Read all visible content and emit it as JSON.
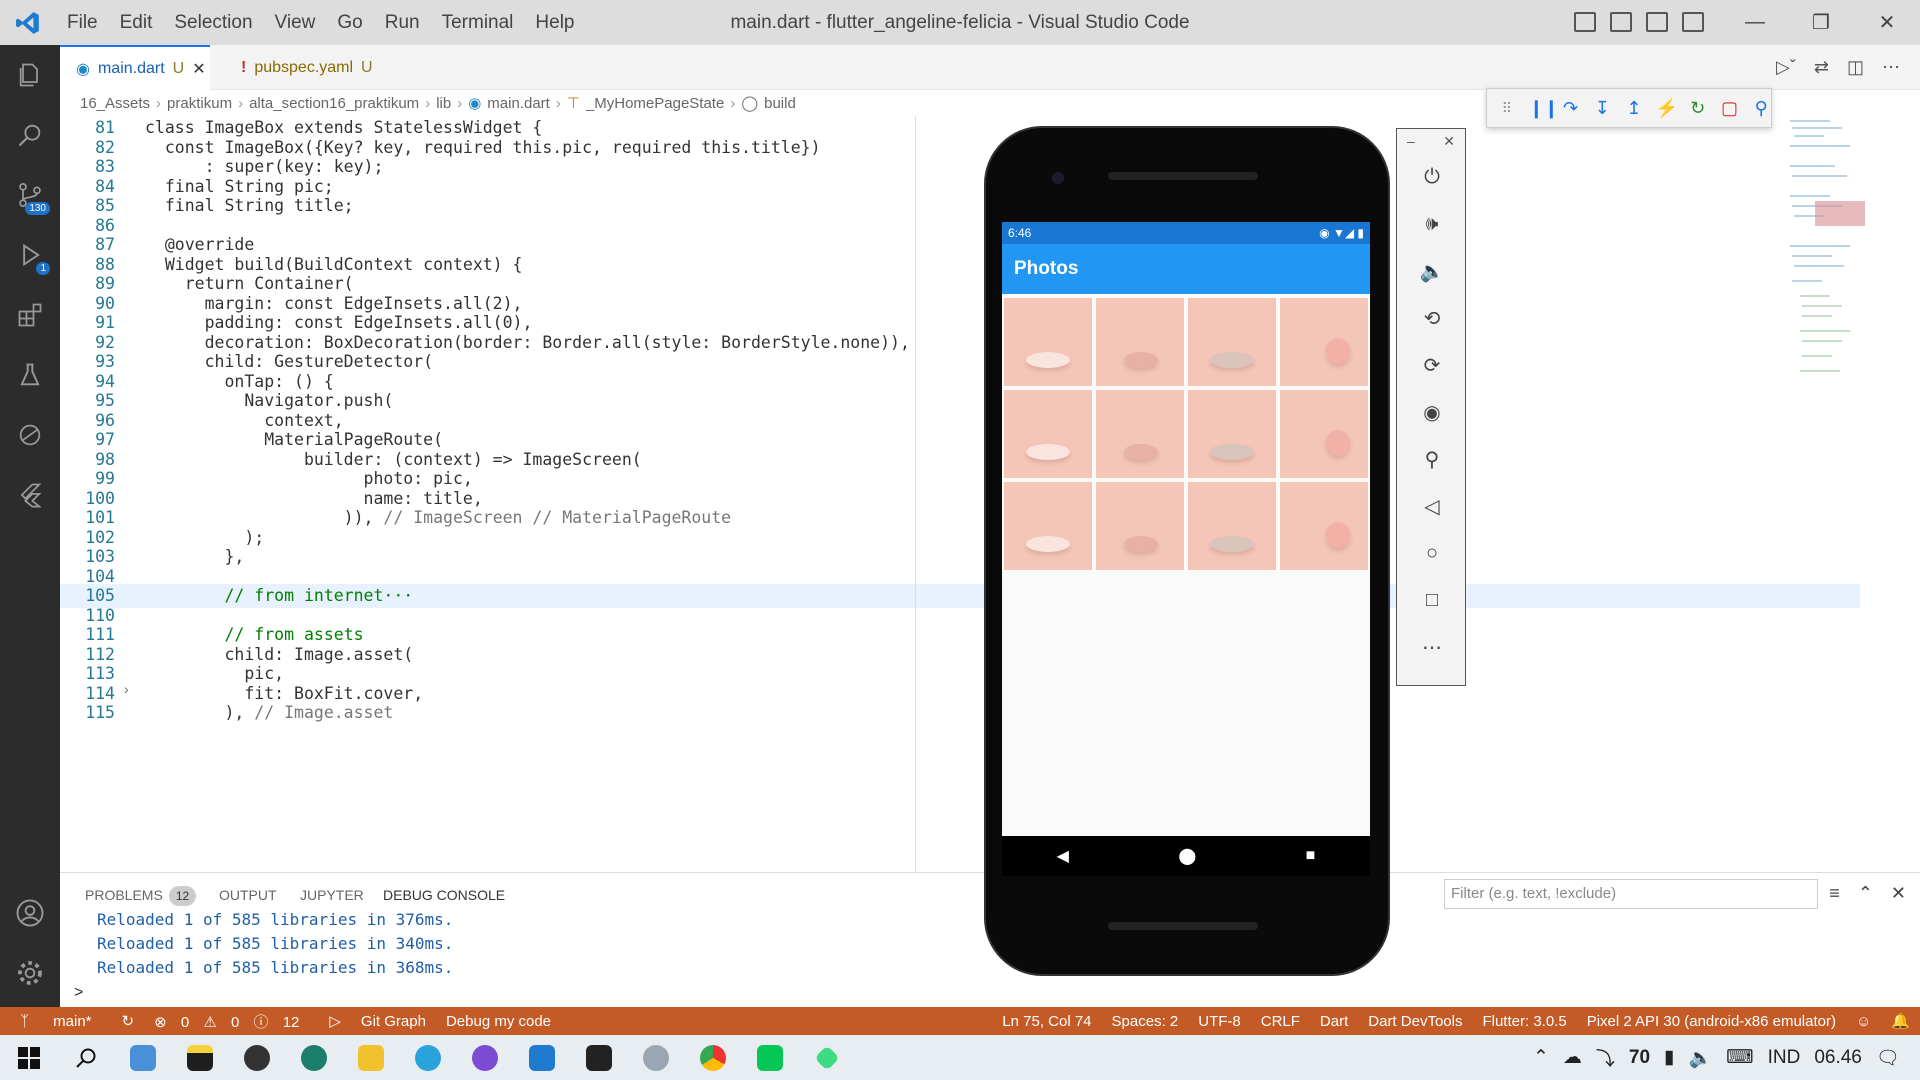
{
  "window": {
    "title": "main.dart - flutter_angeline-felicia - Visual Studio Code",
    "menu": [
      "File",
      "Edit",
      "Selection",
      "View",
      "Go",
      "Run",
      "Terminal",
      "Help"
    ]
  },
  "tabs": [
    {
      "label": "main.dart",
      "status": "U"
    },
    {
      "label": "pubspec.yaml",
      "status": "U"
    }
  ],
  "breadcrumb": [
    "16_Assets",
    "praktikum",
    "alta_section16_praktikum",
    "lib",
    "main.dart",
    "_MyHomePageState",
    "build"
  ],
  "activity": {
    "scm_badge": "130",
    "debug_badge": "1"
  },
  "code": {
    "lines": [
      {
        "n": "81",
        "text": "class ImageBox extends StatelessWidget {"
      },
      {
        "n": "82",
        "text": "  const ImageBox({Key? key, required this.pic, required this.title})"
      },
      {
        "n": "83",
        "text": "      : super(key: key);"
      },
      {
        "n": "84",
        "text": "  final String pic;"
      },
      {
        "n": "85",
        "text": "  final String title;"
      },
      {
        "n": "86",
        "text": ""
      },
      {
        "n": "87",
        "text": "  @override"
      },
      {
        "n": "88",
        "text": "  Widget build(BuildContext context) {"
      },
      {
        "n": "89",
        "text": "    return Container("
      },
      {
        "n": "90",
        "text": "      margin: const EdgeInsets.all(2),"
      },
      {
        "n": "91",
        "text": "      padding: const EdgeInsets.all(0),"
      },
      {
        "n": "92",
        "text": "      decoration: BoxDecoration(border: Border.all(style: BorderStyle.none)),"
      },
      {
        "n": "93",
        "text": "      child: GestureDetector("
      },
      {
        "n": "94",
        "text": "        onTap: () {"
      },
      {
        "n": "95",
        "text": "          Navigator.push("
      },
      {
        "n": "96",
        "text": "            context,"
      },
      {
        "n": "97",
        "text": "            MaterialPageRoute("
      },
      {
        "n": "98",
        "text": "                builder: (context) => ImageScreen("
      },
      {
        "n": "99",
        "text": "                      photo: pic,"
      },
      {
        "n": "100",
        "text": "                      name: title,"
      },
      {
        "n": "101",
        "text": "                    )), // ImageScreen // MaterialPageRoute"
      },
      {
        "n": "102",
        "text": "          );"
      },
      {
        "n": "103",
        "text": "        },"
      },
      {
        "n": "104",
        "text": ""
      },
      {
        "n": "105",
        "text": "        // from internet···"
      },
      {
        "n": "110",
        "text": ""
      },
      {
        "n": "111",
        "text": "        // from assets"
      },
      {
        "n": "112",
        "text": "        child: Image.asset("
      },
      {
        "n": "113",
        "text": "          pic,"
      },
      {
        "n": "114",
        "text": "          fit: BoxFit.cover,"
      },
      {
        "n": "115",
        "text": "        ), // Image.asset"
      }
    ]
  },
  "panel": {
    "tabs": [
      "PROBLEMS",
      "OUTPUT",
      "JUPYTER",
      "DEBUG CONSOLE"
    ],
    "problems_count": "12",
    "filter_placeholder": "Filter (e.g. text, !exclude)",
    "console": [
      "Reloaded 1 of 585 libraries in 376ms.",
      "Reloaded 1 of 585 libraries in 340ms.",
      "Reloaded 1 of 585 libraries in 368ms."
    ],
    "prompt": ">"
  },
  "status": {
    "branch": "main*",
    "errors": "0",
    "warnings": "0",
    "info": "12",
    "gitgraph": "Git Graph",
    "debug": "Debug my code",
    "position": "Ln 75, Col 74",
    "spaces": "Spaces: 2",
    "encoding": "UTF-8",
    "eol": "CRLF",
    "language": "Dart",
    "devtools": "Dart DevTools",
    "flutter": "Flutter: 3.0.5",
    "device": "Pixel 2 API 30 (android-x86 emulator)"
  },
  "phone": {
    "time": "6:46",
    "appbar_title": "Photos"
  },
  "taskbar": {
    "temp": "70",
    "lang": "IND",
    "clock": "06.46"
  }
}
